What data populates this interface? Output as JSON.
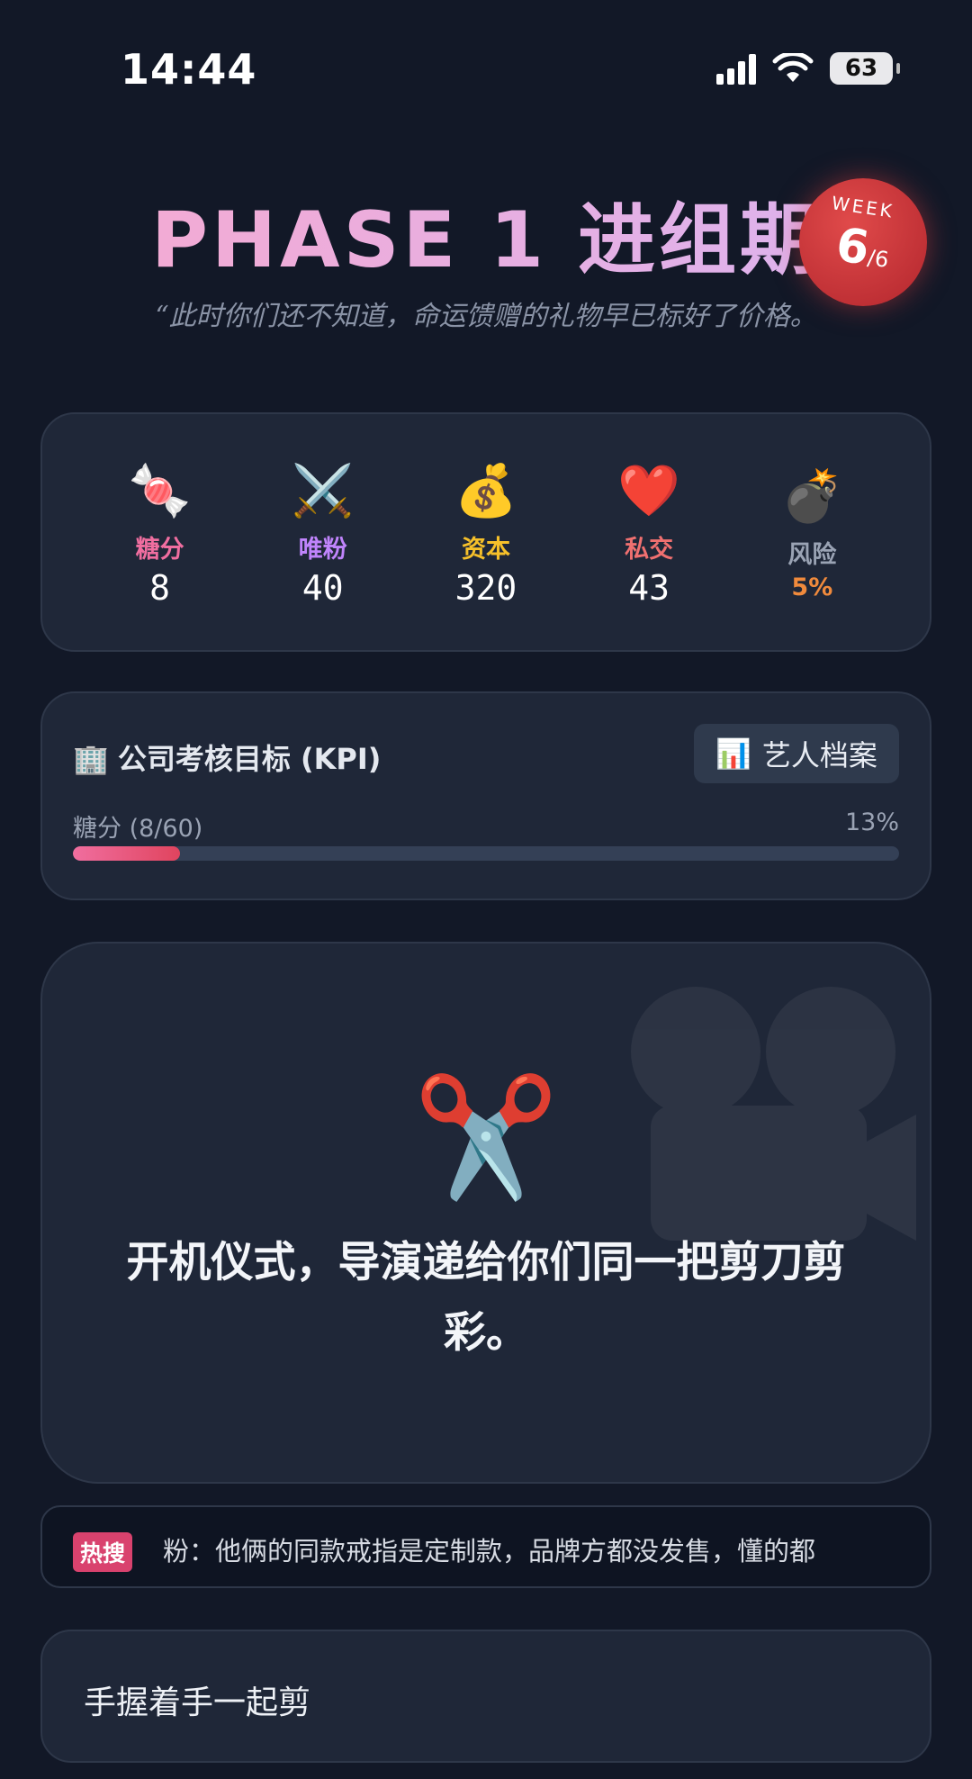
{
  "status_bar": {
    "time": "14:44",
    "battery": "63"
  },
  "header": {
    "title": "PHASE 1 进组期",
    "week_label": "WEEK",
    "week_current": "6",
    "week_total": "/6",
    "quote": "“此时你们还不知道，命运馈赠的礼物早已标好了价格。"
  },
  "stats": [
    {
      "icon": "🍬",
      "label": "糖分",
      "value": "8",
      "color": "#f06ea0"
    },
    {
      "icon": "⚔️",
      "label": "唯粉",
      "value": "40",
      "color": "#c084fc"
    },
    {
      "icon": "💰",
      "label": "资本",
      "value": "320",
      "color": "#f6c02a"
    },
    {
      "icon": "❤️",
      "label": "私交",
      "value": "43",
      "color": "#f07070"
    },
    {
      "icon": "💣",
      "label": "风险",
      "value": "5%",
      "color": "#9aa3b4"
    }
  ],
  "kpi": {
    "icon": "🏢",
    "title": "公司考核目标 (KPI)",
    "button_icon": "📊",
    "button_label": "艺人档案",
    "sub_label": "糖分 (8/60)",
    "percent_text": "13%",
    "progress": 0.13
  },
  "event": {
    "icon": "✂️",
    "text": "开机仪式，导演递给你们同一把剪刀剪彩。"
  },
  "hot_search": {
    "tag": "热搜",
    "text": "粉：他俩的同款戒指是定制款，品牌方都没发售，懂的都"
  },
  "choice": {
    "label": "手握着手一起剪"
  }
}
